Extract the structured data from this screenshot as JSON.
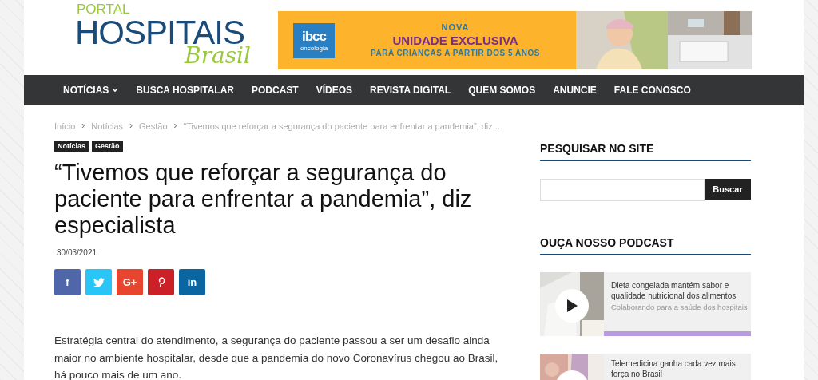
{
  "logo": {
    "top": "PORTAL",
    "main": "HOSPITAIS",
    "script": "Brasil"
  },
  "banner": {
    "brand": "ibcc",
    "brand_sub": "oncologia",
    "line1": "NOVA",
    "line2": "UNIDADE EXCLUSIVA",
    "line3": "PARA CRIANÇAS A PARTIR DOS 5 ANOS"
  },
  "nav": [
    {
      "label": "NOTÍCIAS",
      "dropdown": true
    },
    {
      "label": "BUSCA HOSPITALAR",
      "dropdown": false
    },
    {
      "label": "PODCAST",
      "dropdown": false
    },
    {
      "label": "VÍDEOS",
      "dropdown": false
    },
    {
      "label": "REVISTA DIGITAL",
      "dropdown": false
    },
    {
      "label": "QUEM SOMOS",
      "dropdown": false
    },
    {
      "label": "ANUNCIE",
      "dropdown": false
    },
    {
      "label": "FALE CONOSCO",
      "dropdown": false
    }
  ],
  "breadcrumb": [
    {
      "kind": "link",
      "text": "Início"
    },
    {
      "kind": "separator",
      "text": "›"
    },
    {
      "kind": "link",
      "text": "Notícias"
    },
    {
      "kind": "separator",
      "text": "›"
    },
    {
      "kind": "link",
      "text": "Gestão"
    },
    {
      "kind": "separator",
      "text": "›"
    },
    {
      "kind": "link",
      "text": "“Tivemos que reforçar a segurança do paciente para enfrentar a pandemia”, diz..."
    }
  ],
  "categories": [
    "Notícias",
    "Gestão"
  ],
  "article": {
    "title": "“Tivemos que reforçar a segurança do paciente para enfrentar a pandemia”, diz especialista",
    "date": "30/03/2021",
    "body": "Estratégia central do atendimento, a segurança do paciente passou a ser um desafio ainda maior no ambiente hospitalar, desde que a pandemia do novo Coronavírus chegou ao Brasil, há pouco mais de um ano."
  },
  "share": [
    {
      "kind": "facebook",
      "label": "f"
    },
    {
      "kind": "twitter"
    },
    {
      "kind": "googleplus",
      "label": "G+"
    },
    {
      "kind": "pinterest"
    },
    {
      "kind": "linkedin",
      "label": "in"
    }
  ],
  "sidebar": {
    "search_title": "PESQUISAR NO SITE",
    "search_button": "Buscar",
    "podcast_title": "OUÇA NOSSO PODCAST",
    "podcasts": [
      {
        "title": "Dieta congelada mantém sabor e qualidade nutricional dos alimentos",
        "subtitle": "Colaborando para a saúde dos hospitais",
        "level": 1
      },
      {
        "title": "Telemedicina ganha cada vez mais força no Brasil"
      }
    ]
  }
}
